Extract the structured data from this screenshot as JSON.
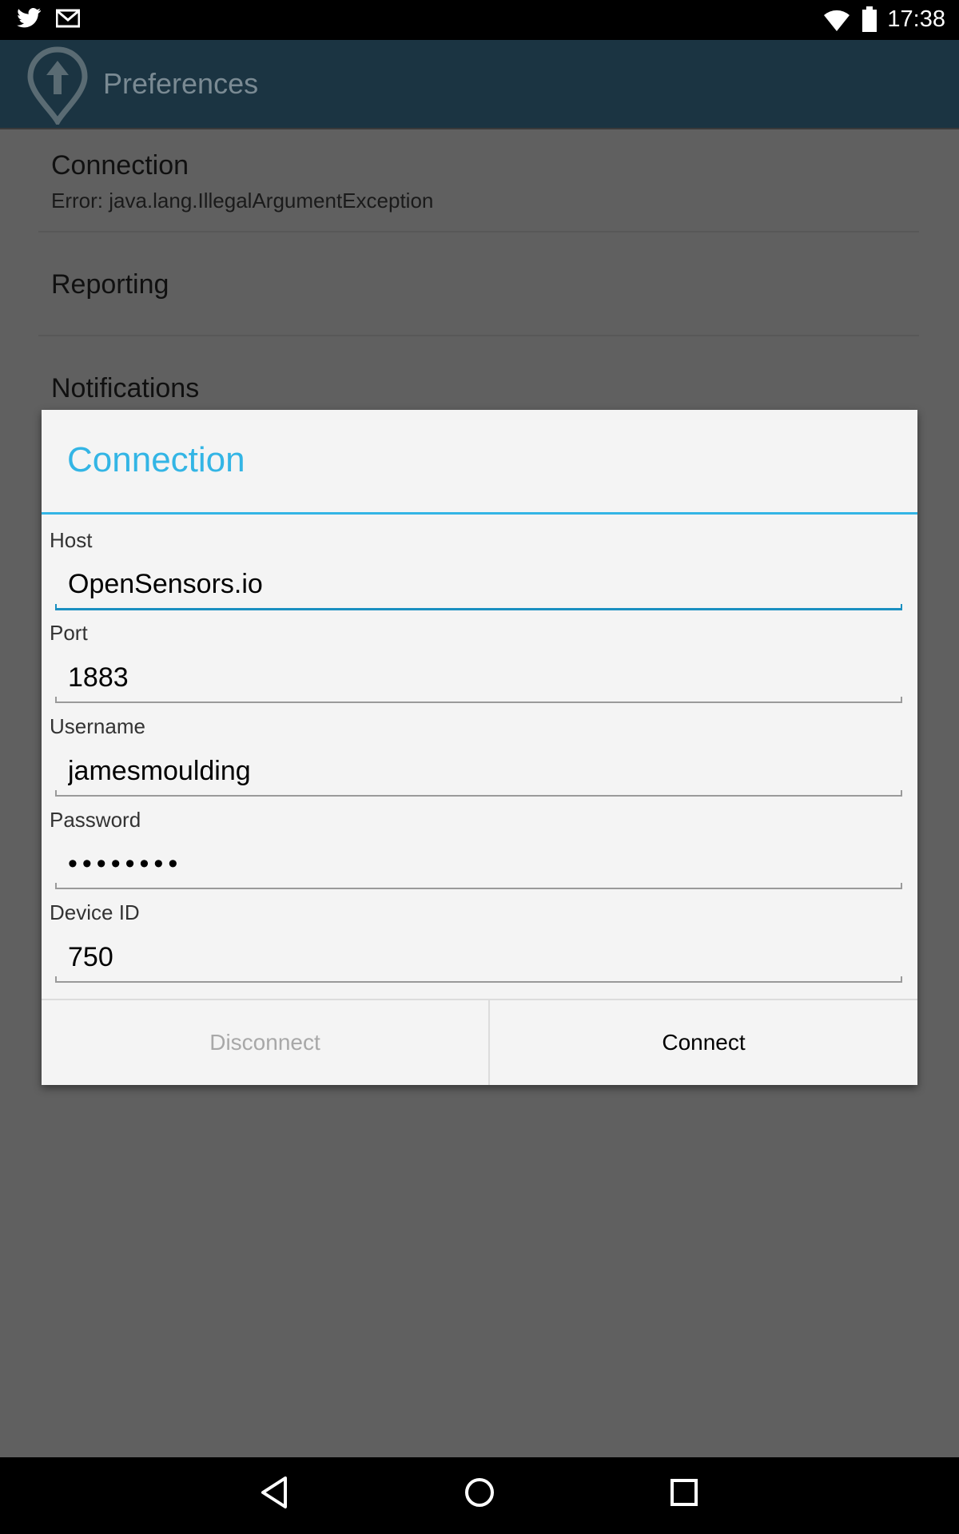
{
  "status_bar": {
    "time": "17:38",
    "icons": [
      "twitter-icon",
      "gmail-icon",
      "wifi-icon",
      "battery-icon"
    ]
  },
  "action_bar": {
    "title": "Preferences",
    "logo_icon": "location-pin-arrow-icon",
    "color": "#1b3442"
  },
  "preferences": {
    "items": [
      {
        "title": "Connection",
        "summary": "Error: java.lang.IllegalArgumentException"
      },
      {
        "title": "Reporting",
        "summary": ""
      },
      {
        "title": "Notifications",
        "summary": ""
      }
    ]
  },
  "dialog": {
    "title": "Connection",
    "accent_color": "#33b5e5",
    "fields": [
      {
        "label": "Host",
        "value": "OpenSensors.io"
      },
      {
        "label": "Port",
        "value": "1883"
      },
      {
        "label": "Username",
        "value": "jamesmoulding"
      },
      {
        "label": "Password",
        "value": "••••••••"
      },
      {
        "label": "Device ID",
        "value": "750"
      }
    ],
    "buttons": {
      "disconnect": "Disconnect",
      "connect": "Connect"
    }
  },
  "nav_bar": {
    "icons": [
      "back-icon",
      "home-icon",
      "recents-icon"
    ]
  }
}
